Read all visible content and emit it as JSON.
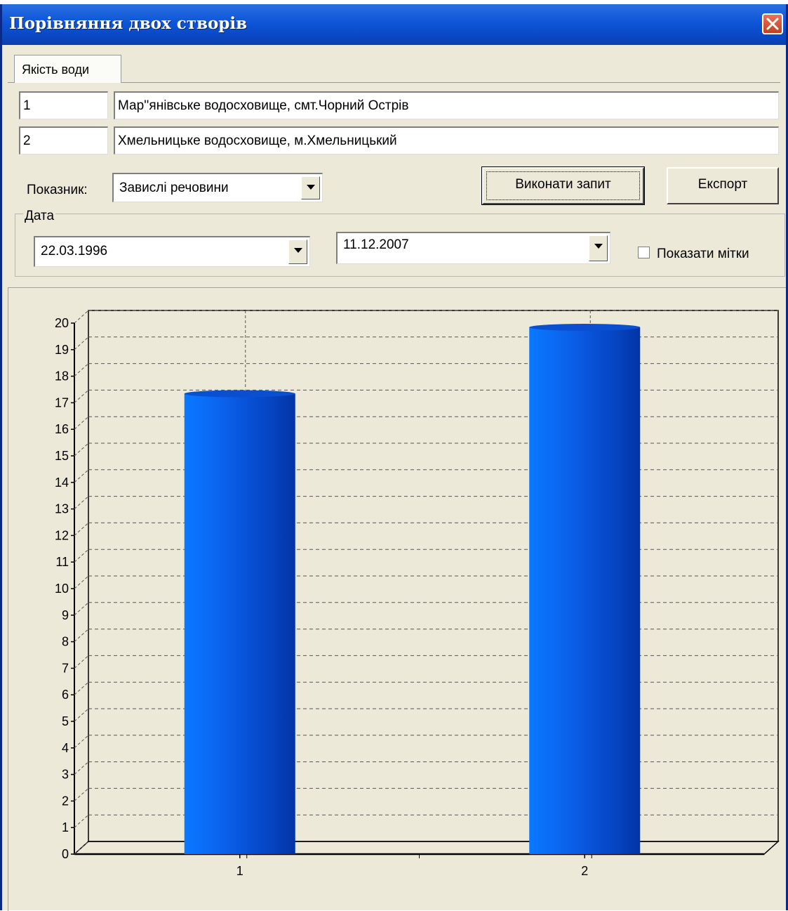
{
  "window": {
    "title": "Порівняння двох створів"
  },
  "tabs": [
    {
      "label": "Якість води"
    }
  ],
  "sites": [
    {
      "code": "1",
      "name": "Мар''янівське водосховище, смт.Чорний Острів"
    },
    {
      "code": "2",
      "name": "Хмельницьке водосховище, м.Хмельницький"
    }
  ],
  "indicator": {
    "label": "Показник:",
    "value": "Завислі речовини"
  },
  "buttons": {
    "execute": "Виконати запит",
    "export": "Експорт"
  },
  "date_group": {
    "title": "Дата",
    "from": "22.03.1996",
    "to": "11.12.2007",
    "show_labels": "Показати мітки",
    "show_labels_checked": false
  },
  "icons": {
    "close": "close-icon",
    "dropdown": "chevron-down-icon"
  },
  "colors": {
    "bar": "#0a55e6",
    "bar_dark": "#0033aa",
    "titlebar": "#0a47c2",
    "window_bg": "#ece9d8"
  },
  "chart_data": {
    "type": "bar",
    "categories": [
      "1",
      "2"
    ],
    "values": [
      17.5,
      20
    ],
    "ylim": [
      0,
      20
    ],
    "y_ticks": [
      "0",
      "1",
      "2",
      "3",
      "4",
      "5",
      "6",
      "7",
      "8",
      "9",
      "10",
      "11",
      "12",
      "13",
      "14",
      "15",
      "16",
      "17",
      "18",
      "19",
      "20"
    ],
    "grid": true,
    "legend": "none",
    "style": "3d-cylinder"
  }
}
